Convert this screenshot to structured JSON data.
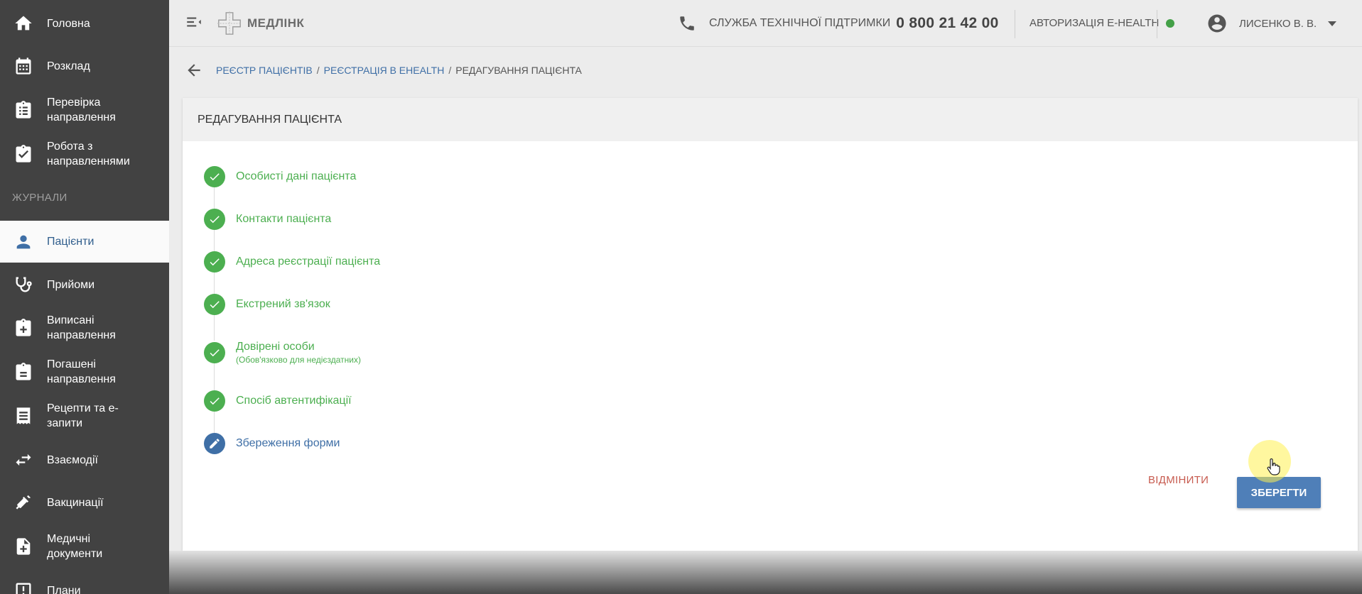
{
  "sidebar": {
    "items": [
      {
        "label": "Головна",
        "icon": "home-icon"
      },
      {
        "label": "Розклад",
        "icon": "calendar-icon"
      },
      {
        "label": "Перевірка направлення",
        "icon": "clipboard-list-icon"
      },
      {
        "label": "Робота з направленнями",
        "icon": "clipboard-check-icon"
      }
    ],
    "section_label": "ЖУРНАЛИ",
    "journal_items": [
      {
        "label": "Пацієнти",
        "icon": "person-icon",
        "active": true
      },
      {
        "label": "Прийоми",
        "icon": "stethoscope-icon"
      },
      {
        "label": "Виписані направлення",
        "icon": "clipboard-plus-icon"
      },
      {
        "label": "Погашені направлення",
        "icon": "clipboard-done-icon"
      },
      {
        "label": "Рецепти та е-запити",
        "icon": "receipt-icon"
      },
      {
        "label": "Взаємодії",
        "icon": "swap-icon"
      },
      {
        "label": "Вакцинації",
        "icon": "syringe-icon"
      },
      {
        "label": "Медичні документи",
        "icon": "medical-doc-icon"
      },
      {
        "label": "Плани",
        "icon": "plan-icon"
      }
    ]
  },
  "header": {
    "logo_text": "МЕДЛІНК",
    "support_label": "СЛУЖБА ТЕХНІЧНОЇ ПІДТРИМКИ",
    "support_phone": "0 800 21 42 00",
    "ehealth_label": "АВТОРИЗАЦІЯ E-HEALTH",
    "ehealth_status_color": "#43a047",
    "user_name": "ЛИСЕНКО В. В."
  },
  "breadcrumb": {
    "items": [
      "РЕЄСТР ПАЦІЄНТІВ",
      "РЕЄСТРАЦІЯ В EHEALTH"
    ],
    "separator": "/",
    "current": "РЕДАГУВАННЯ ПАЦІЄНТА"
  },
  "card": {
    "title": "РЕДАГУВАННЯ ПАЦІЄНТА",
    "steps": [
      {
        "label": "Особисті дані пацієнта",
        "status": "done"
      },
      {
        "label": "Контакти пацієнта",
        "status": "done"
      },
      {
        "label": "Адреса реєстрації пацієнта",
        "status": "done"
      },
      {
        "label": "Екстрений зв'язок",
        "status": "done"
      },
      {
        "label": "Довірені особи",
        "sub": "(Обов'язково для недієздатних)",
        "status": "done"
      },
      {
        "label": "Спосіб автентифікації",
        "status": "done"
      },
      {
        "label": "Збереження форми",
        "status": "current"
      }
    ],
    "cancel_label": "ВІДМІНИТИ",
    "save_label": "ЗБЕРЕГТИ"
  },
  "colors": {
    "sidebar_bg": "#424242",
    "accent_blue": "#3f6fa6",
    "success_green": "#4caf50",
    "cancel_red": "#c75b4f"
  }
}
